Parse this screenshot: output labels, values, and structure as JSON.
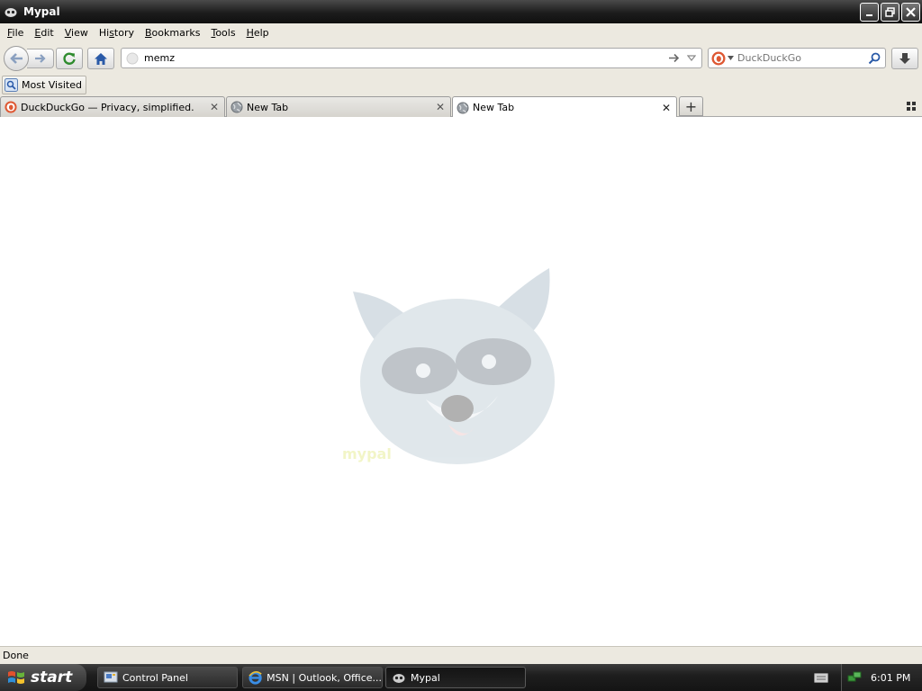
{
  "window": {
    "title": "Mypal"
  },
  "menu": {
    "items": [
      {
        "pre": "",
        "acc": "F",
        "post": "ile"
      },
      {
        "pre": "",
        "acc": "E",
        "post": "dit"
      },
      {
        "pre": "",
        "acc": "V",
        "post": "iew"
      },
      {
        "pre": "Hi",
        "acc": "s",
        "post": "tory"
      },
      {
        "pre": "",
        "acc": "B",
        "post": "ookmarks"
      },
      {
        "pre": "",
        "acc": "T",
        "post": "ools"
      },
      {
        "pre": "",
        "acc": "H",
        "post": "elp"
      }
    ]
  },
  "navbar": {
    "url_value": "memz",
    "search_placeholder": "DuckDuckGo"
  },
  "bookmarks": {
    "most_visited": "Most Visited"
  },
  "tabs": [
    {
      "label": "DuckDuckGo — Privacy, simplified.",
      "icon": "duckduckgo-icon"
    },
    {
      "label": "New Tab",
      "icon": "globe-icon"
    },
    {
      "label": "New Tab",
      "icon": "globe-icon",
      "active": true
    }
  ],
  "status": {
    "text": "Done"
  },
  "taskbar": {
    "start": "start",
    "tasks": [
      {
        "label": "Control Panel",
        "icon": "control-panel-icon"
      },
      {
        "label": "MSN | Outlook, Office...",
        "icon": "internet-explorer-icon"
      },
      {
        "label": "Mypal",
        "icon": "mypal-icon",
        "active": true
      }
    ],
    "clock": "6:01 PM"
  },
  "colors": {
    "titlebar": "#1c1c1c",
    "chrome": "#ece9e0",
    "accent_home": "#2a5aa8",
    "reload_green": "#2e8b2e"
  }
}
